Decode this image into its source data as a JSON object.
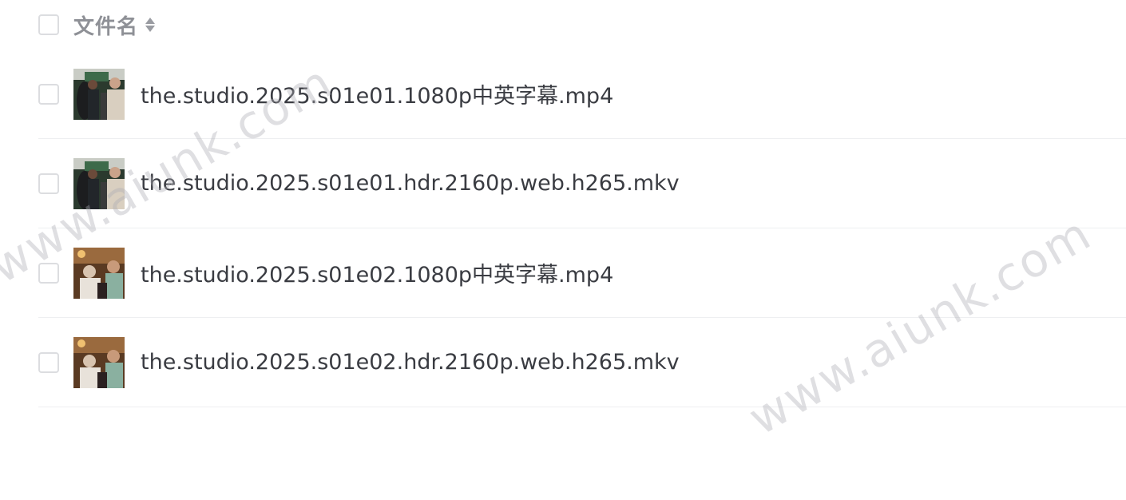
{
  "header": {
    "title": "文件名"
  },
  "files": [
    {
      "name": "the.studio.2025.s01e01.1080p中英字幕.mp4",
      "thumb": "scene-a"
    },
    {
      "name": "the.studio.2025.s01e01.hdr.2160p.web.h265.mkv",
      "thumb": "scene-a"
    },
    {
      "name": "the.studio.2025.s01e02.1080p中英字幕.mp4",
      "thumb": "scene-b"
    },
    {
      "name": "the.studio.2025.s01e02.hdr.2160p.web.h265.mkv",
      "thumb": "scene-b"
    }
  ],
  "watermark": {
    "text": "www.aiunk.com"
  },
  "icons": {
    "sort": "sort-icon",
    "checkbox": "checkbox"
  },
  "colors": {
    "header_text": "#8e9096",
    "filename_text": "#3a3c42",
    "divider": "#eeeff1",
    "checkbox_border": "#dcdde0"
  }
}
